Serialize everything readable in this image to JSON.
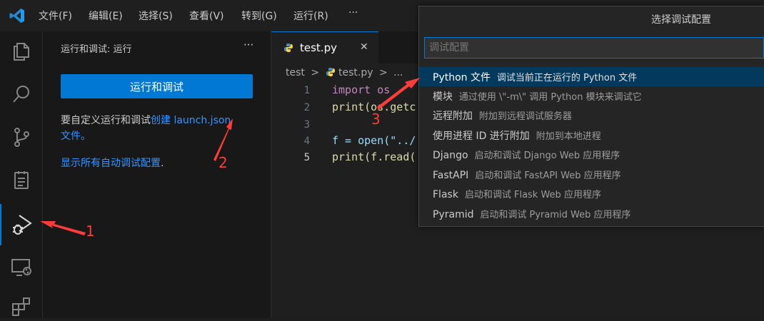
{
  "menu": [
    "文件(F)",
    "编辑(E)",
    "选择(S)",
    "查看(V)",
    "转到(G)",
    "运行(R)",
    "···"
  ],
  "sidebar": {
    "title": "运行和调试: 运行",
    "more": "···",
    "run_button": "运行和调试",
    "desc_prefix": "要自定义运行和调试",
    "desc_link": "创建 launch.json",
    "desc_line2": "文件。",
    "show_all_link": "显示所有自动调试配置",
    "show_all_suffix": "."
  },
  "tab": {
    "name": "test.py",
    "close": "✕"
  },
  "breadcrumb": {
    "folder": "test",
    "sep": ">",
    "file": "test.py",
    "more": "..."
  },
  "editor": {
    "line_numbers": [
      "1",
      "2",
      "3",
      "4",
      "5"
    ],
    "lines": [
      "import os",
      "print(os.getc",
      "",
      "f = open(\"../",
      "print(f.read("
    ]
  },
  "quickpick": {
    "title": "选择调试配置",
    "placeholder": "调试配置",
    "items": [
      {
        "label": "Python 文件",
        "desc": "调试当前正在运行的 Python 文件"
      },
      {
        "label": "模块",
        "desc": "通过使用 \\\"-m\\\" 调用 Python 模块来调试它"
      },
      {
        "label": "远程附加",
        "desc": "附加到远程调试服务器"
      },
      {
        "label": "使用进程 ID 进行附加",
        "desc": "附加到本地进程"
      },
      {
        "label": "Django",
        "desc": "启动和调试 Django Web 应用程序"
      },
      {
        "label": "FastAPI",
        "desc": "启动和调试 FastAPI Web 应用程序"
      },
      {
        "label": "Flask",
        "desc": "启动和调试 Flask Web 应用程序"
      },
      {
        "label": "Pyramid",
        "desc": "启动和调试 Pyramid Web 应用程序"
      }
    ]
  },
  "annotations": [
    "1",
    "2",
    "3"
  ],
  "colors": {
    "accent": "#0078d4",
    "button": "#0078d4",
    "link": "#3794ff",
    "annotation": "#ff3b3b",
    "selected_item": "#04395e"
  },
  "icons": [
    "vscode-logo-icon",
    "explorer-icon",
    "search-icon",
    "source-control-icon",
    "testing-icon",
    "run-debug-icon",
    "remote-explorer-icon",
    "extensions-icon",
    "python-file-icon"
  ]
}
